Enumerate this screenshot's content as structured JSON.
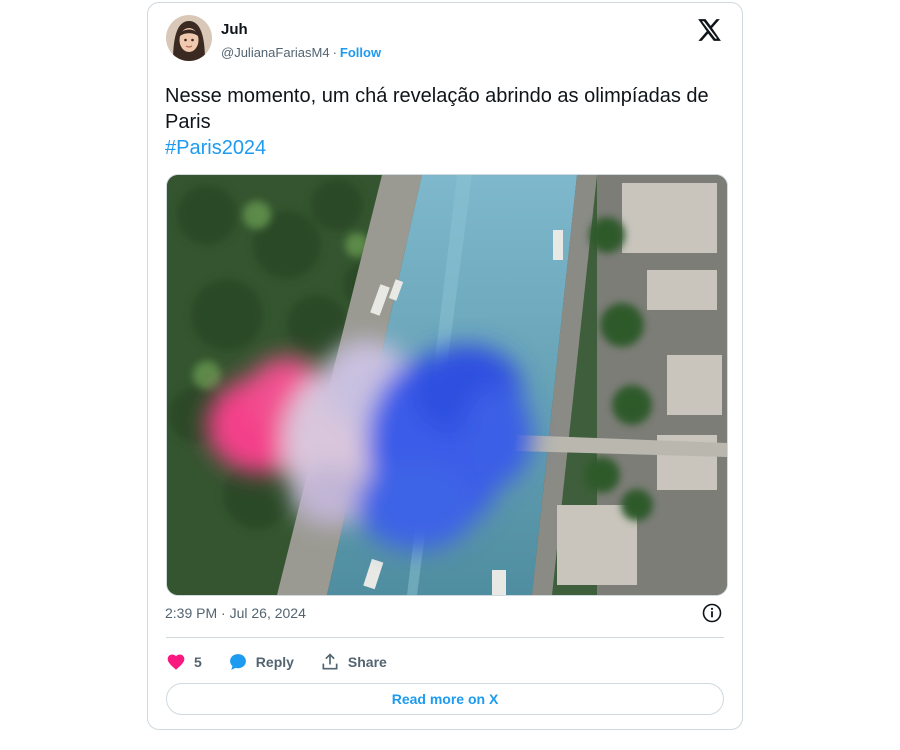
{
  "author": {
    "name": "Juh",
    "handle": "@JulianaFariasM4",
    "separator": "·",
    "follow_label": "Follow"
  },
  "tweet": {
    "text": "Nesse momento, um chá revelação abrindo as olimpíadas de Paris",
    "hashtag": "#Paris2024",
    "timestamp": "2:39 PM · Jul 26, 2024"
  },
  "actions": {
    "like_count": "5",
    "reply_label": "Reply",
    "share_label": "Share",
    "read_more_label": "Read more on X"
  },
  "colors": {
    "accent": "#1d9bf0",
    "like": "#f91880",
    "text_primary": "#0f1419",
    "text_secondary": "#536471",
    "border": "#cfd9de"
  },
  "icons": [
    "x-logo-icon",
    "info-icon",
    "heart-icon",
    "reply-bubble-icon",
    "share-icon"
  ]
}
